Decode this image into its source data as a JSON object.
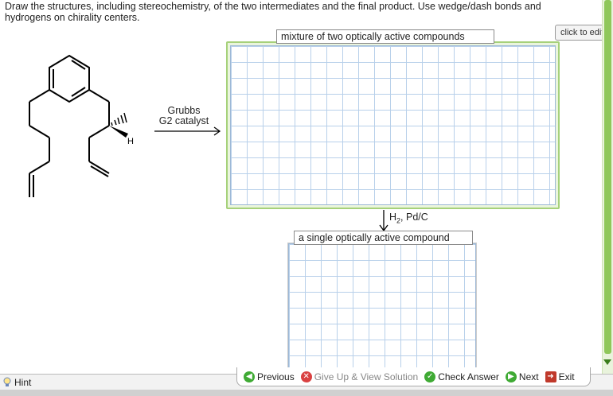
{
  "instructions": "Draw the structures, including stereochemistry, of the two intermediates and the final product. Use wedge/dash bonds and hydrogens on chirality centers.",
  "molecule": {
    "h_label": "H"
  },
  "step1": {
    "reagent_line1": "Grubbs",
    "reagent_line2": "G2 catalyst"
  },
  "panel1": {
    "label": "mixture of two optically active compounds",
    "edit_button": "click to edit"
  },
  "step2": {
    "reagent_h": "H",
    "reagent_sub": "2",
    "reagent_rest": ", Pd/C"
  },
  "panel2": {
    "label": "a single optically active compound"
  },
  "footer": {
    "hint": "Hint",
    "previous": "Previous",
    "give_up": "Give Up & View Solution",
    "check_answer": "Check Answer",
    "next": "Next",
    "exit": "Exit"
  }
}
